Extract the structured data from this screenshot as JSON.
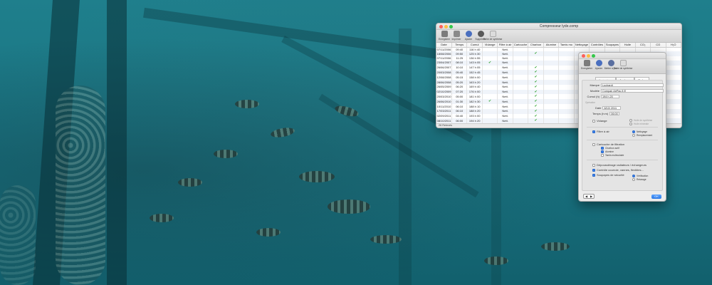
{
  "main_window": {
    "title": "Compresseur lyde.comp",
    "toolbar": {
      "items": [
        {
          "label": "Enregistrer",
          "icon": "save-icon"
        },
        {
          "label": "Imprimer",
          "icon": "printer-icon"
        },
        {
          "label": "Ajouter",
          "icon": "add-icon"
        },
        {
          "label": "Supprimer",
          "icon": "delete-icon"
        },
        {
          "label": "Fiche de synthèse",
          "icon": "summary-icon"
        }
      ]
    },
    "columns": [
      "Date",
      "Temps",
      "Cumul",
      "Vidange",
      "Filtre à air",
      "Cartouche",
      "Charbon",
      "Alumine",
      "Tamis mo",
      "Nettoyage",
      "Contrôles",
      "Soupapes",
      "Huile",
      "CO₂",
      "CO",
      "H₂O"
    ],
    "rows": [
      {
        "date": "07/11/2006",
        "temps": "09:40",
        "cumul": "116 h 40",
        "vidange": false,
        "filtre": "Nett.",
        "cartouche": false,
        "charbon": false
      },
      {
        "date": "18/08/2006",
        "temps": "09:50",
        "cumul": "125 h 30",
        "vidange": false,
        "filtre": "Nett.",
        "cartouche": false,
        "charbon": true
      },
      {
        "date": "07/11/2006",
        "temps": "11:25",
        "cumul": "136 h 55",
        "vidange": false,
        "filtre": "Nett.",
        "cartouche": false,
        "charbon": false
      },
      {
        "date": "23/04/2007",
        "temps": "08:10",
        "cumul": "143 h 05",
        "vidange": true,
        "filtre": "Nett.",
        "cartouche": false,
        "charbon": false
      },
      {
        "date": "26/06/2007",
        "temps": "10:10",
        "cumul": "147 h 05",
        "vidange": false,
        "filtre": "Nett.",
        "cartouche": false,
        "charbon": true
      },
      {
        "date": "20/03/2008",
        "temps": "05:40",
        "cumul": "152 h 45",
        "vidange": false,
        "filtre": "Nett.",
        "cartouche": false,
        "charbon": true
      },
      {
        "date": "12/08/2008",
        "temps": "05:15",
        "cumul": "158 h 00",
        "vidange": false,
        "filtre": "Nett.",
        "cartouche": false,
        "charbon": true
      },
      {
        "date": "28/06/2008",
        "temps": "05:20",
        "cumul": "163 h 20",
        "vidange": false,
        "filtre": "Nett.",
        "cartouche": false,
        "charbon": true
      },
      {
        "date": "26/05/2009",
        "temps": "06:20",
        "cumul": "169 h 40",
        "vidange": false,
        "filtre": "Nett.",
        "cartouche": false,
        "charbon": true
      },
      {
        "date": "02/10/2009",
        "temps": "07:20",
        "cumul": "176 h 00",
        "vidange": false,
        "filtre": "Nett.",
        "cartouche": false,
        "charbon": true
      },
      {
        "date": "20/03/2010",
        "temps": "05:00",
        "cumul": "181 h 00",
        "vidange": false,
        "filtre": "Nett.",
        "cartouche": false,
        "charbon": true
      },
      {
        "date": "26/06/2010",
        "temps": "01:30",
        "cumul": "182 h 30",
        "vidange": true,
        "filtre": "Nett.",
        "cartouche": false,
        "charbon": true
      },
      {
        "date": "10/11/2010",
        "temps": "06:10",
        "cumul": "188 h 10",
        "vidange": false,
        "filtre": "Nett.",
        "cartouche": false,
        "charbon": true
      },
      {
        "date": "17/03/2011",
        "temps": "06:10",
        "cumul": "188 h 20",
        "vidange": false,
        "filtre": "Nett.",
        "cartouche": false,
        "charbon": true
      },
      {
        "date": "02/09/2011",
        "temps": "04:40",
        "cumul": "193 h 00",
        "vidange": false,
        "filtre": "Nett.",
        "cartouche": false,
        "charbon": true
      },
      {
        "date": "08/10/2011",
        "temps": "06:00",
        "cumul": "194 h 20",
        "vidange": false,
        "filtre": "Nett.",
        "cartouche": false,
        "charbon": true
      },
      {
        "date": "20/06/2012",
        "temps": "04:35",
        "cumul": "195 h 55",
        "vidange": false,
        "filtre": "Nett.",
        "cartouche": false,
        "charbon": true
      },
      {
        "date": "03/10/2013",
        "temps": "00:00",
        "cumul": "",
        "vidange": false,
        "filtre": "",
        "cartouche": false,
        "charbon": false
      },
      {
        "date": "20/11/2016",
        "temps": "00:00",
        "cumul": "",
        "vidange": false,
        "filtre": "",
        "cartouche": false,
        "charbon": false
      }
    ],
    "status_text": "26 Relevés"
  },
  "detail_window": {
    "toolbar": {
      "items": [
        {
          "label": "Enregistrer",
          "icon": "save-icon"
        },
        {
          "label": "Ajouter",
          "icon": "add-icon"
        },
        {
          "label": "Mettre à jour",
          "icon": "update-icon"
        },
        {
          "label": "Fiche de synthèse",
          "icon": "summary-icon"
        }
      ]
    },
    "tabs": [
      "Opérations",
      "Analyses",
      "Notes"
    ],
    "active_tab": "Notes",
    "fields": {
      "marque_label": "Marque",
      "marque_value": "Luchardi",
      "modele_label": "Modèle",
      "modele_value": "Compair AirPac 8 E",
      "cumul_label": "Cumul (h)",
      "cumul_value": "194 h 20"
    },
    "section_label": "Opération",
    "date_label": "Date",
    "date_value": "8/10/ 2011",
    "temps_label": "Temps (h:m)",
    "temps_value": "06:00",
    "options": {
      "vidange": "Vidange",
      "vidange_sub1": "Huile de synthèse",
      "vidange_sub2": "Huile minérale",
      "filtre": "Filtre à air",
      "filtre_sub1": "Nettoyage",
      "filtre_sub2": "Remplacement",
      "cartouche": "Cartouche de filtration",
      "cartouche_sub1": "Charbon actif",
      "cartouche_sub2": "Alumine",
      "cartouche_sub3": "Tamis moléculaire",
      "depoussierage": "Dépoussiérage radiateurs / échangeurs",
      "controle": "Contrôle courroie, vannes, flexibles...",
      "soupapes": "Soupapes de sécurité",
      "soupapes_sub1": "Vérification",
      "soupapes_sub2": "Retarage"
    },
    "ok_label": "OK",
    "nav_prev": "◀",
    "nav_next": "▶"
  },
  "icons": {
    "check": "✔"
  }
}
